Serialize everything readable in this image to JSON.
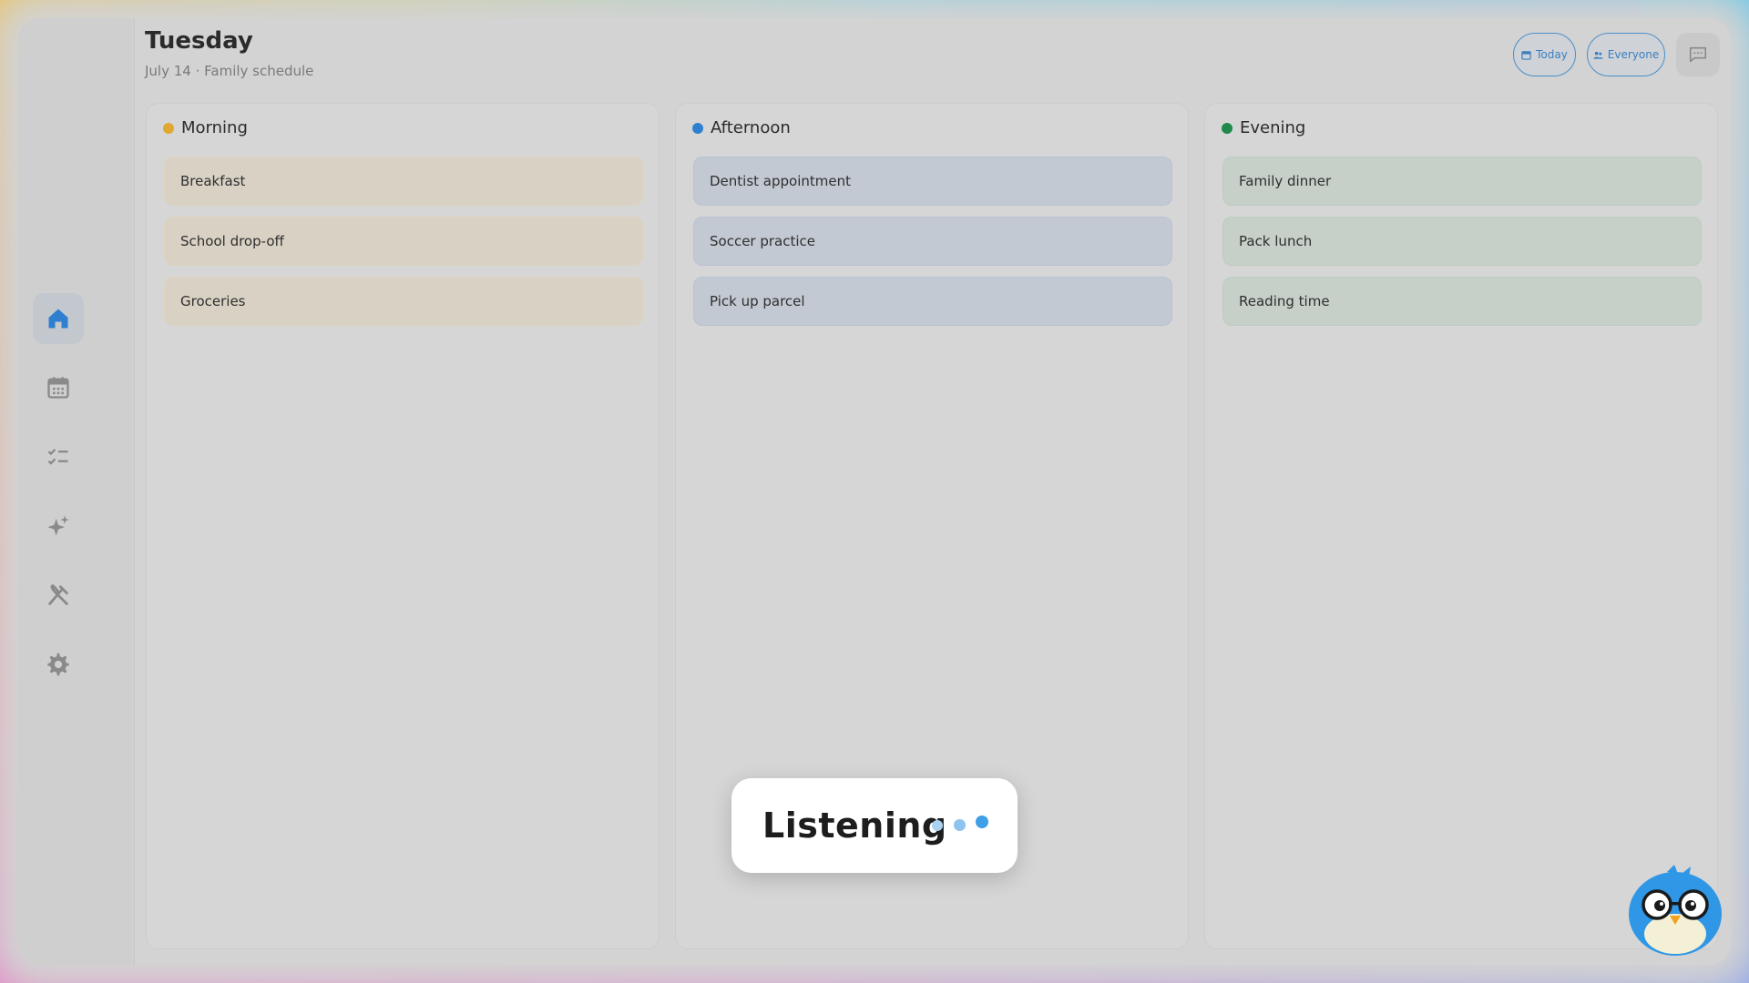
{
  "header": {
    "title": "Tuesday",
    "subtitle": "July 14 · Family schedule",
    "today_label": "Today",
    "everyone_label": "Everyone"
  },
  "sidebar": {
    "items": [
      {
        "name": "home",
        "icon": "home-icon",
        "active": true
      },
      {
        "name": "calendar",
        "icon": "calendar-icon",
        "active": false
      },
      {
        "name": "tasks",
        "icon": "checklist-icon",
        "active": false
      },
      {
        "name": "magic",
        "icon": "sparkles-icon",
        "active": false
      },
      {
        "name": "meals",
        "icon": "utensils-icon",
        "active": false
      },
      {
        "name": "settings",
        "icon": "gear-icon",
        "active": false
      }
    ]
  },
  "columns": [
    {
      "title": "Morning",
      "color": "#e0a82e",
      "items": [
        "Breakfast",
        "School drop-off",
        "Groceries"
      ]
    },
    {
      "title": "Afternoon",
      "color": "#2f7fd0",
      "items": [
        "Dentist appointment",
        "Soccer practice",
        "Pick up parcel"
      ]
    },
    {
      "title": "Evening",
      "color": "#1f8a4c",
      "items": [
        "Family dinner",
        "Pack lunch",
        "Reading time"
      ]
    }
  ],
  "voice": {
    "status": "Listening"
  },
  "colors": {
    "accent": "#3a7fc0",
    "active_nav": "#2f7fd0",
    "icon_gray": "#8a8a8a"
  }
}
